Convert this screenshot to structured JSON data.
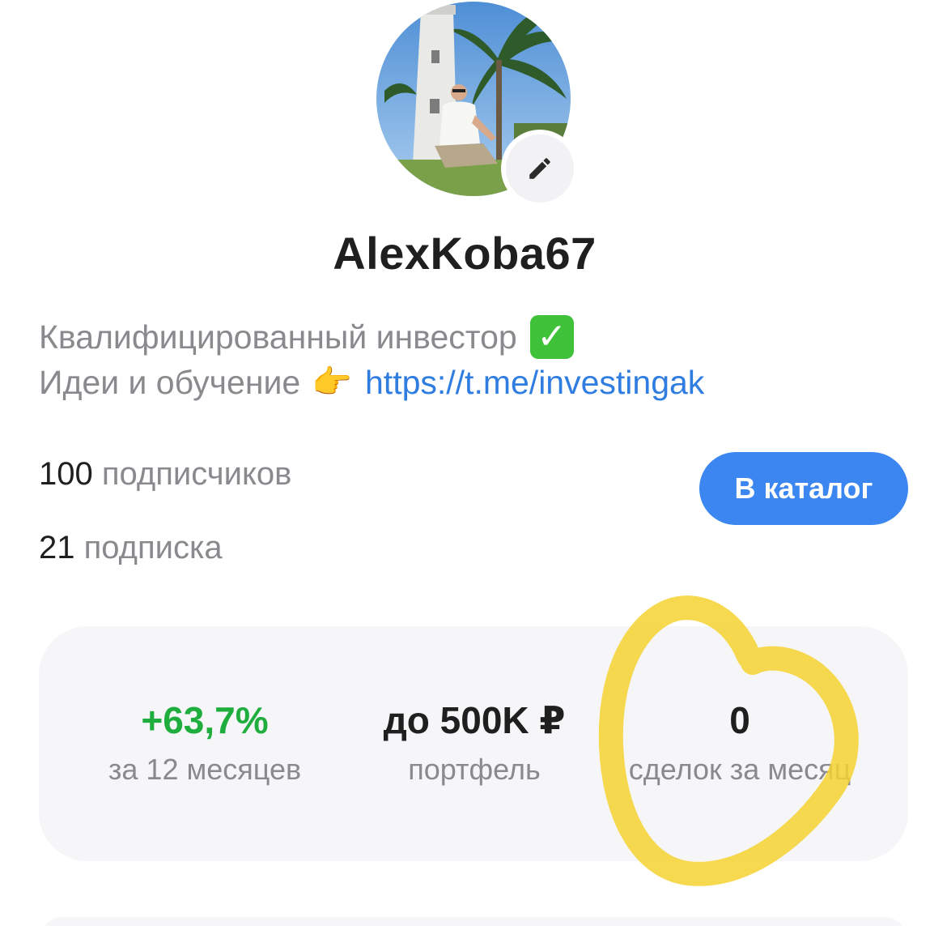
{
  "profile": {
    "username": "AlexKoba67",
    "bio_line1": "Квалифицированный инвестор",
    "bio_line1_emoji": "✓",
    "bio_line2": "Идеи и обучение",
    "bio_line2_emoji": "👉",
    "bio_link": "https://t.me/investingak"
  },
  "social": {
    "followers_count": "100",
    "followers_label": "подписчиков",
    "following_count": "21",
    "following_label": "подписка",
    "catalog_button": "В каталог"
  },
  "stats": [
    {
      "value": "+63,7%",
      "label": "за 12 месяцев",
      "color": "#1fae3e"
    },
    {
      "value": "до 500K ₽",
      "label": "портфель",
      "color": "#1f1f1f"
    },
    {
      "value": "0",
      "label": "сделок за месяц",
      "color": "#1f1f1f"
    }
  ],
  "colors": {
    "accent": "#3b86f0",
    "link": "#2f7de1",
    "positive": "#1fae3e",
    "highlight": "#f5d230"
  },
  "icons": {
    "edit": "pencil-icon",
    "verified": "check-mark-emoji",
    "pointer": "pointing-hand-emoji"
  }
}
